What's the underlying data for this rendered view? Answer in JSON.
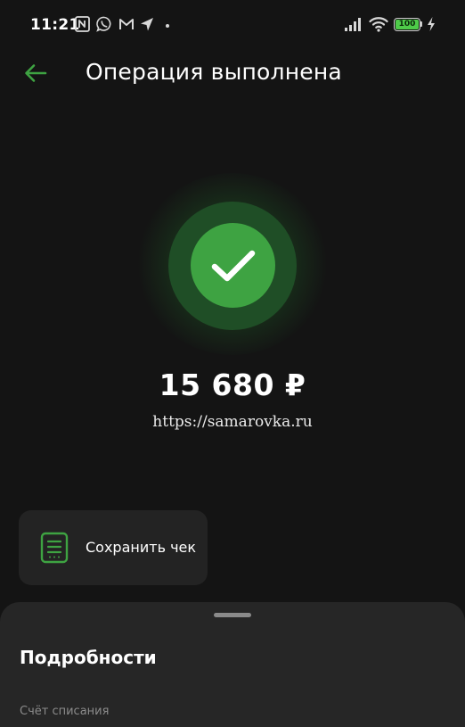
{
  "status_bar": {
    "time": "11:21",
    "battery": "100",
    "icons": [
      "nfc-icon",
      "whatsapp-icon",
      "gmail-icon",
      "location-arrow-icon",
      "dot-icon",
      "signal-icon",
      "wifi-icon",
      "battery-icon",
      "charging-bolt-icon"
    ]
  },
  "header": {
    "back_icon": "arrow-left-icon",
    "title": "Операция выполнена"
  },
  "result": {
    "status_icon": "checkmark-icon",
    "amount": "15 680 ₽",
    "recipient": "https://samarovka.ru"
  },
  "actions": {
    "save_receipt_label": "Сохранить чек",
    "save_receipt_icon": "receipt-icon"
  },
  "details": {
    "title": "Подробности",
    "first_field_label": "Счёт списания"
  },
  "colors": {
    "background": "#141414",
    "accent_green": "#3ea342",
    "card": "#232323",
    "sheet": "#262626"
  }
}
